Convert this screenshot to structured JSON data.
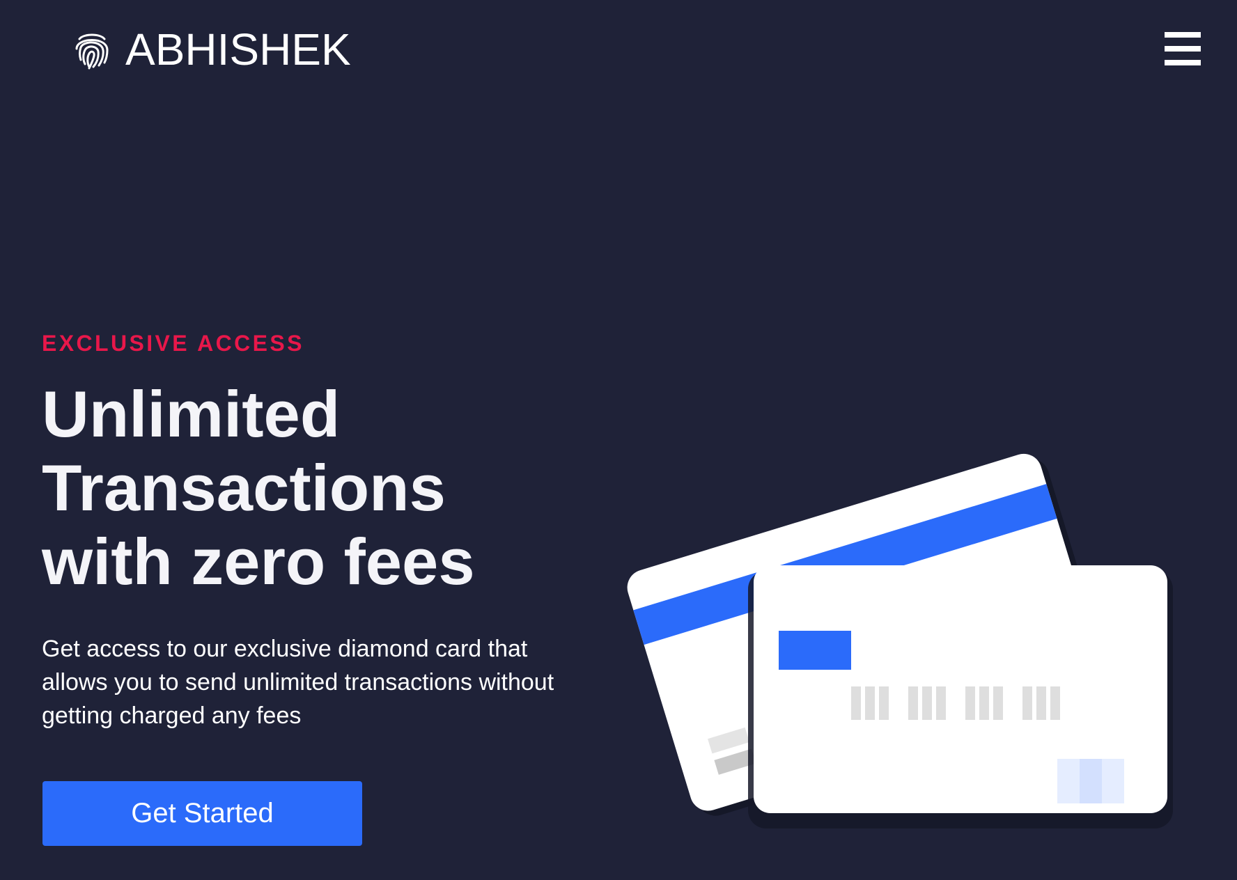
{
  "nav": {
    "brand": "ABHISHEK",
    "logo_icon": "fingerprint-icon",
    "menu_icon": "hamburger-menu-icon"
  },
  "hero": {
    "eyebrow": "EXCLUSIVE ACCESS",
    "headline_lines": [
      "Unlimited",
      "Transactions",
      "with zero fees"
    ],
    "description": "Get access to our exclusive diamond card that allows you to send unlimited transactions without getting charged any fees",
    "cta_label": "Get Started"
  },
  "illustration": {
    "icon": "credit-cards-illustration"
  },
  "colors": {
    "background": "#1f2238",
    "accent_red": "#e8174a",
    "primary_blue": "#2b6bfa",
    "text": "#ffffff"
  }
}
